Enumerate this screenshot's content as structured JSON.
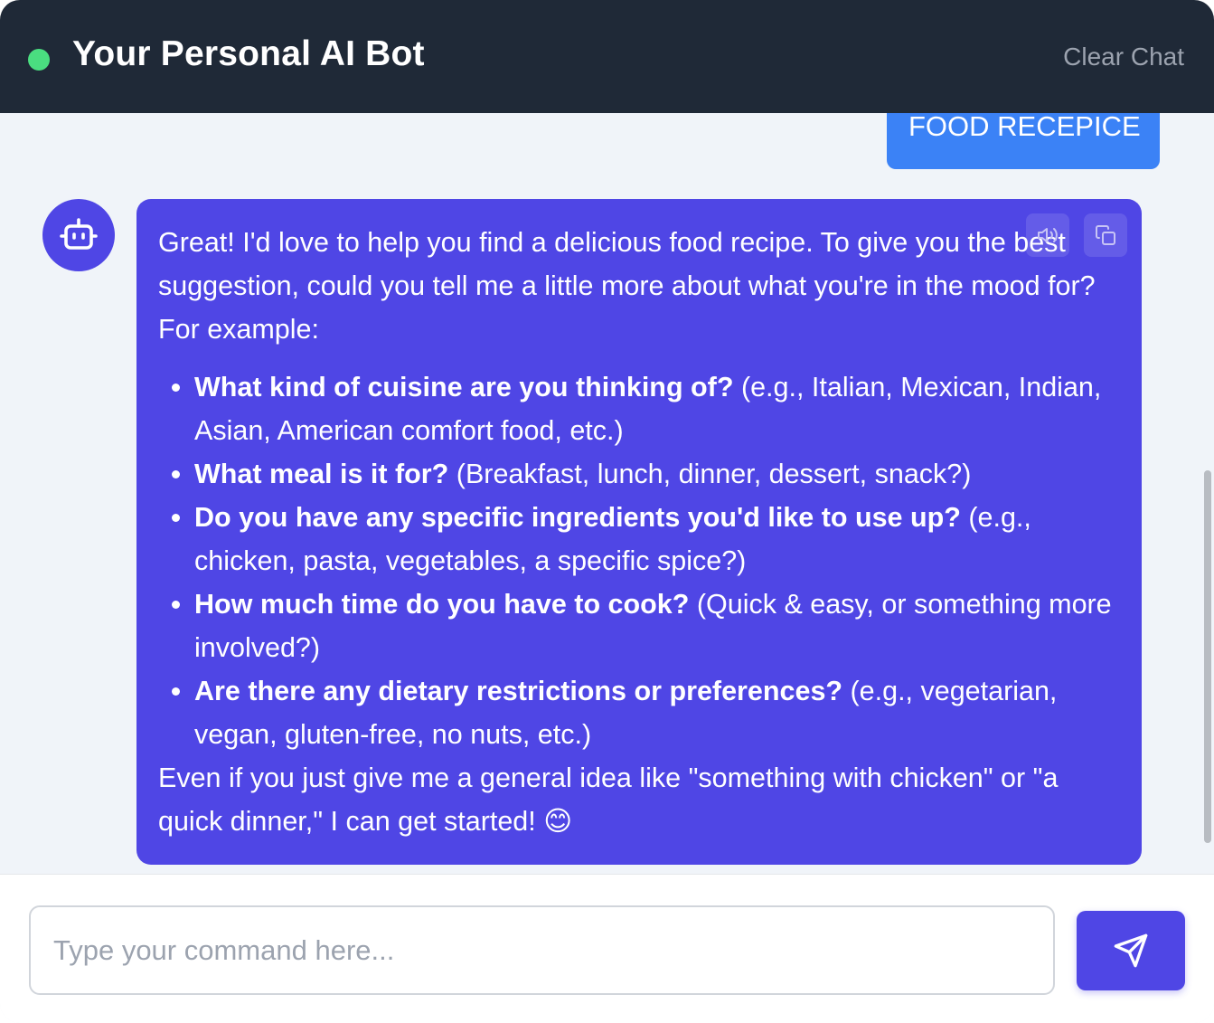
{
  "header": {
    "title": "Your Personal AI Bot",
    "clear_label": "Clear Chat",
    "status_color": "#4ade80"
  },
  "messages": {
    "user": {
      "text": "FOOD RECEPICE"
    },
    "bot": {
      "intro": "Great! I'd love to help you find a delicious food recipe. To give you the best suggestion, could you tell me a little more about what you're in the mood for? For example:",
      "items": [
        {
          "question": "What kind of cuisine are you thinking of?",
          "detail": " (e.g., Italian, Mexican, Indian, Asian, American comfort food, etc.)"
        },
        {
          "question": "What meal is it for?",
          "detail": " (Breakfast, lunch, dinner, dessert, snack?)"
        },
        {
          "question": "Do you have any specific ingredients you'd like to use up?",
          "detail": " (e.g., chicken, pasta, vegetables, a specific spice?)"
        },
        {
          "question": "How much time do you have to cook?",
          "detail": " (Quick & easy, or something more involved?)"
        },
        {
          "question": "Are there any dietary restrictions or preferences?",
          "detail": " (e.g., vegetarian, vegan, gluten-free, no nuts, etc.)"
        }
      ],
      "outro": "Even if you just give me a general idea like \"something with chicken\" or \"a quick dinner,\" I can get started! 😊"
    }
  },
  "input": {
    "placeholder": "Type your command here...",
    "value": ""
  },
  "icons": {
    "avatar": "robot-icon",
    "speak": "speaker-icon",
    "copy": "copy-icon",
    "send": "send-icon"
  },
  "colors": {
    "header_bg": "#1f2937",
    "accent": "#4f46e5",
    "user_bubble": "#3b82f6",
    "chat_bg": "#f0f4f9"
  }
}
